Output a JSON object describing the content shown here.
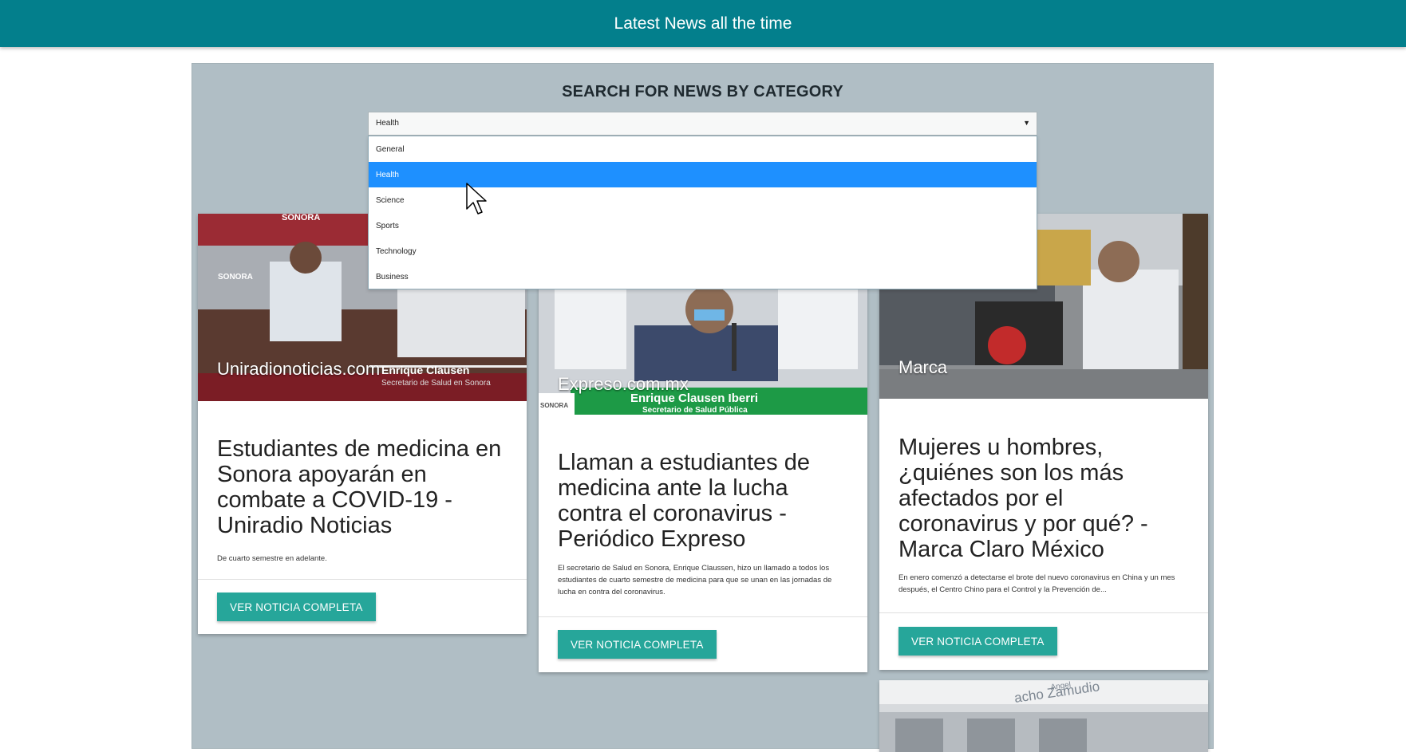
{
  "header": {
    "title": "Latest News all the time"
  },
  "search": {
    "heading": "SEARCH FOR NEWS BY CATEGORY",
    "selected": "Health",
    "arrow": "▼",
    "options": [
      "General",
      "Health",
      "Science",
      "Sports",
      "Technology",
      "Business"
    ]
  },
  "articles": [
    {
      "source": "Uniradionoticias.com",
      "title": "Estudiantes de medicina en Sonora apoyarán en combate a COVID-19 - Uniradio Noticias",
      "description": "De cuarto semestre en adelante.",
      "button": "VER NOTICIA COMPLETA",
      "image_text": [
        "SONORA",
        "Enrique Clausen",
        "Secretario de Salud en Sonora"
      ]
    },
    {
      "source": "Expreso.com.mx",
      "title": "Llaman a estudiantes de medicina ante la lucha contra el coronavirus - Periódico Expreso",
      "description": "El secretario de Salud en Sonora, Enrique Claussen, hizo un llamado a todos los estudiantes de cuarto semestre de medicina para que se unan en las jornadas de lucha en contra del coronavirus.",
      "button": "VER NOTICIA COMPLETA",
      "image_text": [
        "Enrique Clausen Iberri",
        "Secretario de Salud Pública",
        "SONORA"
      ]
    },
    {
      "source": "Marca",
      "title": "Mujeres u hombres, ¿quiénes son los más afectados por el coronavirus y por qué? - Marca Claro México",
      "description": "En enero comenzó a detectarse el brote del nuevo coronavirus en China y un mes después, el Centro Chino para el Control y la Prevención de...",
      "button": "VER NOTICIA COMPLETA"
    },
    {
      "image_text": [
        "acho Zamudio",
        "Angel"
      ]
    }
  ],
  "colors": {
    "header": "#037f8c",
    "panel": "#b0bec5",
    "button": "#26a69a",
    "selected_option": "#1e90ff"
  }
}
